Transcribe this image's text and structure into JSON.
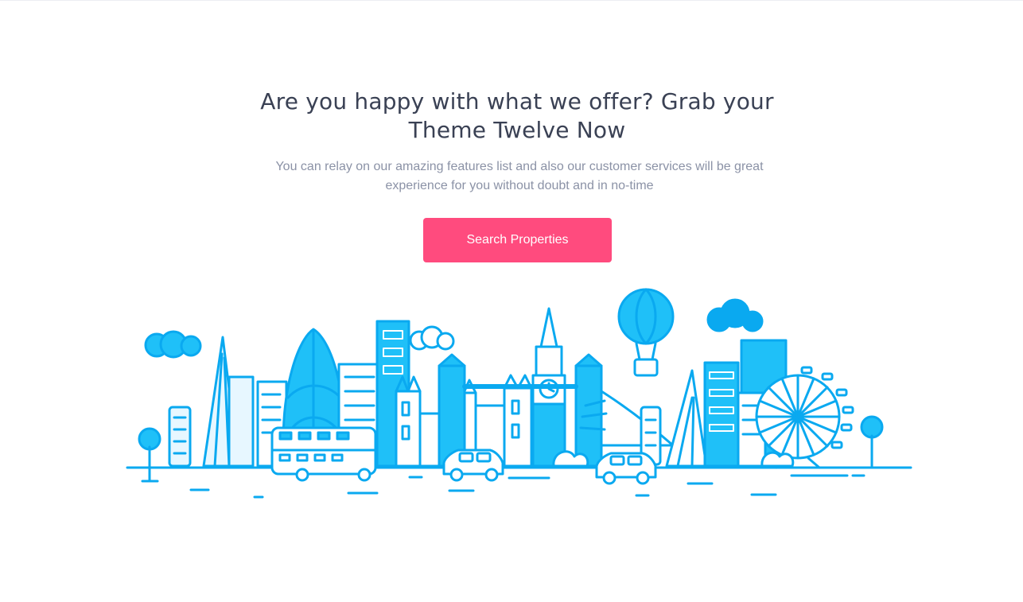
{
  "cta": {
    "headline": "Are you happy with what we offer? Grab your Theme Twelve Now",
    "subtext": "You can relay on our amazing features list and also our customer services will be great experience for you without doubt and in no-time",
    "button_label": "Search Properties"
  },
  "colors": {
    "accent": "#ff4b7e",
    "heading": "#3a4154",
    "body_text": "#8b92a6",
    "illustration_primary": "#0aa9f0",
    "illustration_light": "#1fc0f8"
  },
  "illustration": {
    "icons": [
      "clouds-icon",
      "tree-icon",
      "shard-tower-icon",
      "gherkin-tower-icon",
      "bus-icon",
      "big-ben-icon",
      "hot-air-balloon-icon",
      "tower-bridge-icon",
      "london-eye-icon",
      "car-icon",
      "phone-box-icon"
    ]
  }
}
